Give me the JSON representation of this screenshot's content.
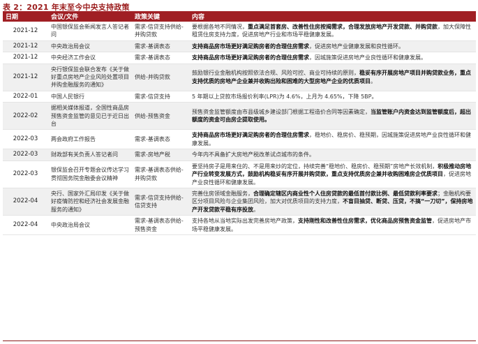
{
  "title": "表 2：2021 年末至今中央支持政策",
  "columns": [
    "日期",
    "会议/文件",
    "政策关键",
    "内容"
  ],
  "rows": [
    {
      "date": "2021-12",
      "doc": "中国银保监会新闻发言人答记者问",
      "key": "需求-信贷支持供给-并购贷款",
      "content": [
        {
          "t": "要根据各地不同情况，"
        },
        {
          "t": "重点满足首套房、改善性住房按揭需求，合理发放房地产开发贷款、并购贷款",
          "b": true
        },
        {
          "t": "，加大保障性租赁住房支持力度，促进房地产行业和市场平稳健康发展。"
        }
      ]
    },
    {
      "date": "2021-12",
      "doc": "中央政治局会议",
      "key": "需求-基调表态",
      "content": [
        {
          "t": "支持商品房市场更好满足购房者的合理住房需求",
          "b": true
        },
        {
          "t": "，促进房地产业健康发展和良性循环。"
        }
      ]
    },
    {
      "date": "2021-12",
      "doc": "中央经济工作会议",
      "key": "需求-基调表态",
      "content": [
        {
          "t": "支持商品房市场更好满足购房者的合理住房需求",
          "b": true
        },
        {
          "t": "，因城施策促进房地产业良性循环和健康发展。"
        }
      ]
    },
    {
      "date": "2021-12",
      "doc": "央行银保监会联合发布《关于做好重点房地产企业风险处置项目并购金融服务的通知》",
      "key": "供给-并购贷款",
      "content": [
        {
          "t": "鼓励银行业金融机构按照依法合规、风险可控、商业可持续的原则，"
        },
        {
          "t": "稳妥有序开展房地产项目并购贷款业务，重点支持优质的房地产企业兼并收购出险和困难的大型房地产企业的优质项目",
          "b": true
        },
        {
          "t": "。"
        }
      ]
    },
    {
      "date": "2022-01",
      "doc": "中国人民银行",
      "key": "需求-信贷支持",
      "content": [
        {
          "t": "5 年期以上贷款市场报价利率(LPR)为 4.6%，上月为 4.65%，下降 5BP。"
        }
      ]
    },
    {
      "date": "2022-02",
      "doc": "据相关媒体报道，全国性商品房预售资金监管的意见已于近日出台",
      "key": "供给-预售资金",
      "content": [
        {
          "t": "预售资金监管额度由市县级城乡建设部门根据工程造价合同等因素确定，"
        },
        {
          "t": "当监管账户内资金达到监管额度后，超出额度的资金可由房企提取使用。",
          "b": true
        }
      ]
    },
    {
      "date": "2022-03",
      "doc": "两会政府工作报告",
      "key": "需求-基调表态",
      "content": [
        {
          "t": "支持商品房市场更好满足购房者的合理住房需求",
          "b": true
        },
        {
          "t": "，稳地价、稳房价、稳预期，因城施策促进房地产业良性循环和健康发展。"
        }
      ]
    },
    {
      "date": "2022-03",
      "doc": "财政部有关负责人答记者问",
      "key": "需求-房地产税",
      "content": [
        {
          "t": "今年内不具备扩大房地产税改革试点城市的条件。"
        }
      ]
    },
    {
      "date": "2022-03",
      "doc": "银保监会召开专题会议传达学习贯彻国务院金融委会议精神",
      "key": "需求-基调表态供给-并购贷款",
      "content": [
        {
          "t": "要坚持房子是用来住的、不是用来炒的定位，持续完善“稳地价、稳房价、稳预期”房地产长效机制，"
        },
        {
          "t": "积极推动房地产行业转变发展方式，鼓励机构稳妥有序开展并购贷款，重点支持优质房企兼并收购困难房企优质项目",
          "b": true
        },
        {
          "t": "，促进房地产业良性循环和健康发展。"
        }
      ]
    },
    {
      "date": "2022-04",
      "doc": "央行、国家外汇局印发《关于做好疫情防控和经济社会发展金融服务的通知》",
      "key": "需求-信贷支持供给-信贷支持",
      "content": [
        {
          "t": "完善住房领域金融服务，"
        },
        {
          "t": "合理确定辖区内商业性个人住房贷款的最低首付款比例、最低贷款利率要求",
          "b": true
        },
        {
          "t": "；金融机构要区分项目风险与企业集团风险，加大对优质项目的支持力度，"
        },
        {
          "t": "不盲目抽贷、断贷、压贷，不搞“一刀切”，保持房地产开发贷款平稳有序投放",
          "b": true
        },
        {
          "t": "。"
        }
      ]
    },
    {
      "date": "2022-04",
      "doc": "中央政治局会议",
      "key": "需求-基调表态供给-预售资金",
      "content": [
        {
          "t": "支持各地从当地实际出发完善房地产政策，"
        },
        {
          "t": "支持刚性和改善性住房需求，优化商品房预售资金监管",
          "b": true
        },
        {
          "t": "，促进房地产市场平稳健康发展。"
        }
      ]
    }
  ]
}
